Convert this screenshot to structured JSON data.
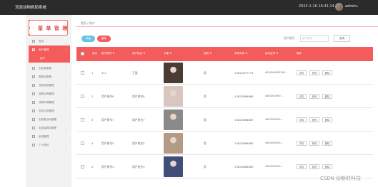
{
  "topbar": {
    "title": "流浪动物救助系统",
    "clock": "2024-1-16 16:41:14",
    "user": "admin",
    "caret": "▾"
  },
  "sidebar": {
    "title": "菜 单 管 理",
    "items": [
      {
        "label": "首页"
      },
      {
        "label": "用户管理",
        "active": true
      },
      {
        "label": "用户",
        "submenu": true
      },
      {
        "label": "志愿者管理"
      },
      {
        "label": "救助站管理"
      },
      {
        "label": "流浪动物管理"
      },
      {
        "label": "宠物认养管理"
      },
      {
        "label": "领养申请管理"
      },
      {
        "label": "回访记录管理"
      },
      {
        "label": "志愿者活动管理"
      },
      {
        "label": "志愿者报名管理"
      },
      {
        "label": "系统管理"
      },
      {
        "label": "个人资料"
      }
    ]
  },
  "breadcrumb": "首页 / 用户",
  "toolbar": {
    "add": "添加",
    "delete": "删除",
    "search_label": "用户账号",
    "search_placeholder": "用户账号",
    "search_btn": "查询"
  },
  "table": {
    "headers": [
      "索引",
      "用户账号",
      "用户姓名",
      "头像",
      "性别",
      "手机号码",
      "身份证号",
      "操作"
    ],
    "sort_mark": "⇅",
    "rows": [
      {
        "idx": "1",
        "account": "111",
        "name": "王强",
        "gender": "男",
        "phone": "13823877774",
        "idcard": "4414561987000...",
        "photo": "#4a3b34"
      },
      {
        "idx": "2",
        "account": "用户账号8",
        "name": "用户姓名8",
        "gender": "男",
        "phone": "13823888888",
        "idcard": "4400001990...",
        "photo": "#d9c7bf"
      },
      {
        "idx": "3",
        "account": "用户账号7",
        "name": "用户姓名7",
        "gender": "男",
        "phone": "13823888887",
        "idcard": "4400001990...",
        "photo": "#8a8a8a"
      },
      {
        "idx": "4",
        "account": "用户账号5",
        "name": "用户姓名5",
        "gender": "男",
        "phone": "13823888885",
        "idcard": "4400001990...",
        "photo": "#b39a84"
      },
      {
        "idx": "5",
        "account": "用户账号3",
        "name": "用户姓名3",
        "gender": "男",
        "phone": "13823888883",
        "idcard": "4400001990...",
        "photo": "#3f4f7a"
      }
    ],
    "ops": {
      "detail": "详情",
      "edit": "修改",
      "delete": "删除"
    }
  },
  "watermark": "CSDN @新时科技"
}
